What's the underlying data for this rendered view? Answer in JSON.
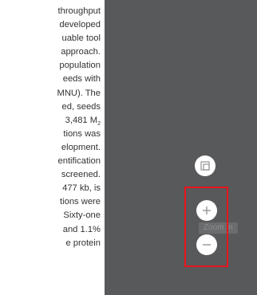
{
  "article": {
    "lines": [
      {
        "text": "throughput",
        "sub": ""
      },
      {
        "text": "developed",
        "sub": ""
      },
      {
        "text": "uable tool",
        "sub": ""
      },
      {
        "text": "approach.",
        "sub": ""
      },
      {
        "text": "population",
        "sub": ""
      },
      {
        "text": "eeds with",
        "sub": ""
      },
      {
        "text": "MNU). The",
        "sub": ""
      },
      {
        "text": "ed, seeds",
        "sub": ""
      },
      {
        "text": "3,481 M",
        "sub": "2"
      },
      {
        "text": "tions was",
        "sub": ""
      },
      {
        "text": "elopment.",
        "sub": ""
      },
      {
        "text": "entification",
        "sub": ""
      },
      {
        "text": "screened.",
        "sub": ""
      },
      {
        "text": "477 kb, is",
        "sub": ""
      },
      {
        "text": "tions were",
        "sub": ""
      },
      {
        "text": "Sixty-one",
        "sub": ""
      },
      {
        "text": "and 1.1%",
        "sub": ""
      },
      {
        "text": "e protein",
        "sub": ""
      }
    ]
  },
  "viewer": {
    "tooltip": "Zoom In",
    "buttons": {
      "fit": "fit-screen-icon",
      "zoom_in": "plus-icon",
      "zoom_out": "minus-icon"
    },
    "colors": {
      "panel_bg": "#58595b",
      "button_bg": "#ffffff",
      "icon": "#9c9c9c",
      "highlight": "#e8141b"
    }
  }
}
